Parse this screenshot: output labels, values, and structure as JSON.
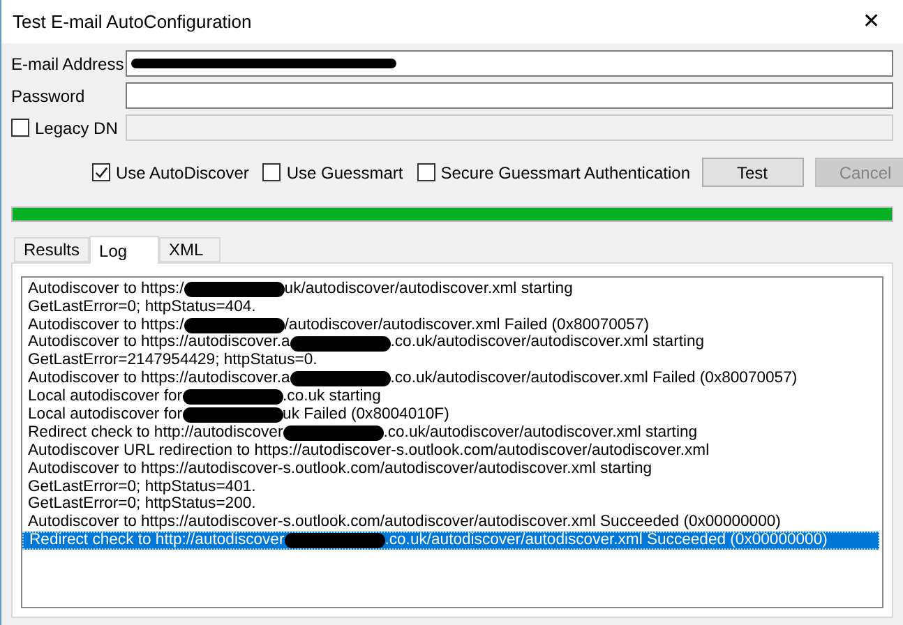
{
  "window": {
    "title": "Test E-mail AutoConfiguration",
    "close": "✕"
  },
  "fields": [
    {
      "label": "E-mail Address",
      "redacted": true
    },
    {
      "label": "Password",
      "redacted": false
    }
  ],
  "legacy_dn": {
    "label": "Legacy DN",
    "checked": false,
    "disabled": true
  },
  "options": [
    {
      "label": "Use AutoDiscover",
      "checked": true
    },
    {
      "label": "Use Guessmart",
      "checked": false
    },
    {
      "label": "Secure Guessmart Authentication",
      "checked": false
    }
  ],
  "buttons": [
    {
      "label": "Test",
      "disabled": false
    },
    {
      "label": "Cancel",
      "disabled": true
    }
  ],
  "progress": {
    "level": 1
  },
  "tabs": [
    {
      "label": "Results",
      "selected": false
    },
    {
      "label": "Log",
      "selected": true
    },
    {
      "label": "XML",
      "selected": false
    }
  ],
  "log": [
    {
      "segments": [
        "Autodiscover to https:/",
        "uk/autodiscover/autodiscover.xml starting"
      ],
      "selected": false
    },
    {
      "segments": [
        "GetLastError=0; httpStatus=404."
      ],
      "selected": false
    },
    {
      "segments": [
        "Autodiscover to https:/",
        "/autodiscover/autodiscover.xml Failed (0x80070057)"
      ],
      "selected": false
    },
    {
      "segments": [
        "Autodiscover to https://autodiscover.a",
        ".co.uk/autodiscover/autodiscover.xml starting"
      ],
      "selected": false
    },
    {
      "segments": [
        "GetLastError=2147954429; httpStatus=0."
      ],
      "selected": false
    },
    {
      "segments": [
        "Autodiscover to https://autodiscover.a",
        ".co.uk/autodiscover/autodiscover.xml Failed (0x80070057)"
      ],
      "selected": false
    },
    {
      "segments": [
        "Local autodiscover for",
        ".co.uk starting"
      ],
      "selected": false
    },
    {
      "segments": [
        "Local autodiscover for",
        "uk Failed (0x8004010F)"
      ],
      "selected": false
    },
    {
      "segments": [
        "Redirect check to http://autodiscover",
        ".co.uk/autodiscover/autodiscover.xml starting"
      ],
      "selected": false
    },
    {
      "segments": [
        "Autodiscover URL redirection to https://autodiscover-s.outlook.com/autodiscover/autodiscover.xml"
      ],
      "selected": false
    },
    {
      "segments": [
        "Autodiscover to https://autodiscover-s.outlook.com/autodiscover/autodiscover.xml starting"
      ],
      "selected": false
    },
    {
      "segments": [
        "GetLastError=0; httpStatus=401."
      ],
      "selected": false
    },
    {
      "segments": [
        "GetLastError=0; httpStatus=200."
      ],
      "selected": false
    },
    {
      "segments": [
        "Autodiscover to https://autodiscover-s.outlook.com/autodiscover/autodiscover.xml Succeeded (0x00000000)"
      ],
      "selected": false
    },
    {
      "segments": [
        "Redirect check to http://autodiscover",
        ".co.uk/autodiscover/autodiscover.xml Succeeded (0x00000000)"
      ],
      "selected": true
    }
  ]
}
